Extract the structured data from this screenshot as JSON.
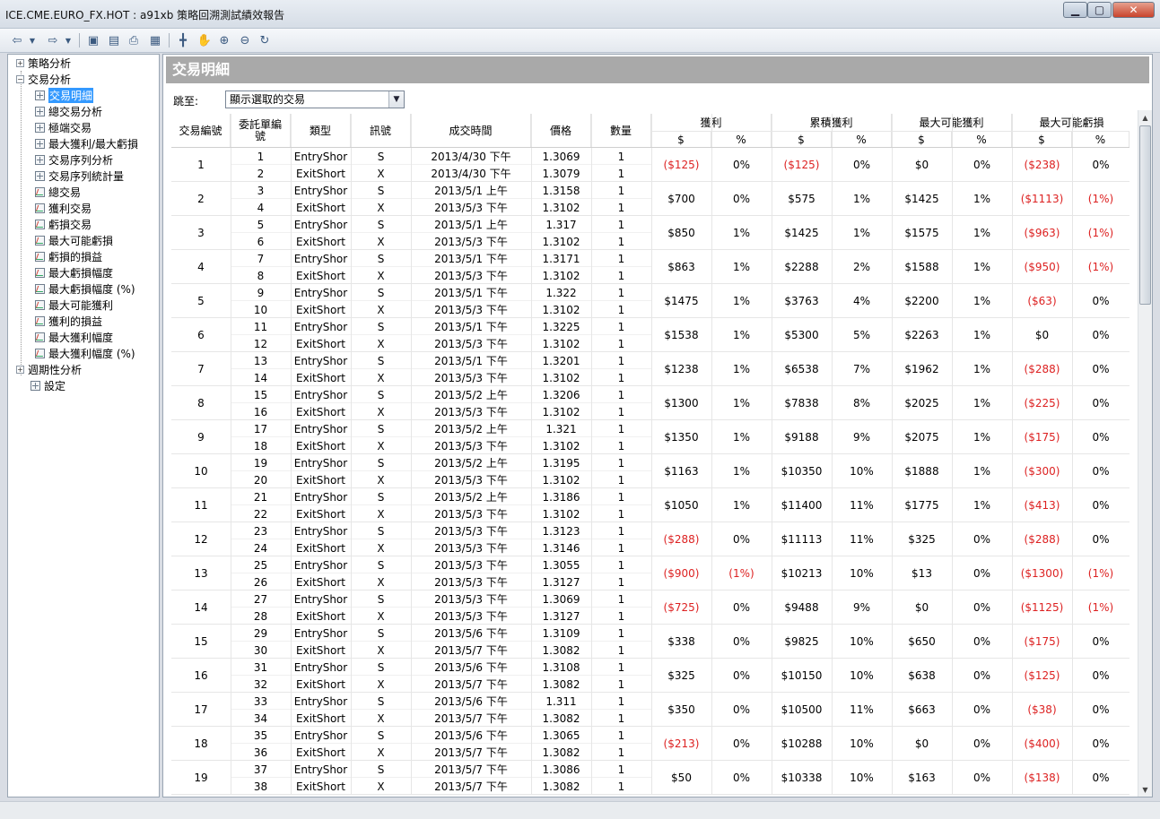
{
  "window": {
    "title": "ICE.CME.EURO_FX.HOT : a91xb 策略回溯測試績效報告"
  },
  "colors": {
    "negative": "#dd2222",
    "header_bar": "#a9a9a9"
  },
  "toolbar": {
    "icons": [
      "back-arrow-icon",
      "dropdown-icon",
      "forward-arrow-icon",
      "dropdown-icon",
      "save-icon",
      "export-icon",
      "print-icon",
      "view-icon",
      "crosshair-icon",
      "pan-hand-icon",
      "zoom-in-icon",
      "zoom-out-icon",
      "reset-zoom-icon"
    ]
  },
  "sidebar": {
    "groups": [
      {
        "label": "策略分析",
        "expanded": false
      },
      {
        "label": "交易分析",
        "expanded": true
      },
      {
        "label": "週期性分析",
        "expanded": false
      },
      {
        "label": "設定",
        "expanded": false
      }
    ],
    "items": [
      {
        "label": "交易明細",
        "icon": "grid",
        "selected": true
      },
      {
        "label": "總交易分析",
        "icon": "grid"
      },
      {
        "label": "極端交易",
        "icon": "grid"
      },
      {
        "label": "最大獲利/最大虧損",
        "icon": "grid"
      },
      {
        "label": "交易序列分析",
        "icon": "grid"
      },
      {
        "label": "交易序列統計量",
        "icon": "grid"
      },
      {
        "label": "總交易",
        "icon": "chart"
      },
      {
        "label": "獲利交易",
        "icon": "chart"
      },
      {
        "label": "虧損交易",
        "icon": "chart"
      },
      {
        "label": "最大可能虧損",
        "icon": "chart"
      },
      {
        "label": "虧損的損益",
        "icon": "chart"
      },
      {
        "label": "最大虧損幅度",
        "icon": "chart"
      },
      {
        "label": "最大虧損幅度 (%)",
        "icon": "chart"
      },
      {
        "label": "最大可能獲利",
        "icon": "chart"
      },
      {
        "label": "獲利的損益",
        "icon": "chart"
      },
      {
        "label": "最大獲利幅度",
        "icon": "chart"
      },
      {
        "label": "最大獲利幅度 (%)",
        "icon": "chart"
      }
    ]
  },
  "main": {
    "section_title": "交易明細",
    "jump_label": "跳至:",
    "jump_value": "顯示選取的交易",
    "headers": {
      "trade_no": "交易編號",
      "order_no": "委託單編號",
      "type": "類型",
      "signal": "訊號",
      "time": "成交時間",
      "price": "價格",
      "qty": "數量",
      "profit": "獲利",
      "cum_profit": "累積獲利",
      "max_profit": "最大可能獲利",
      "max_loss": "最大可能虧損",
      "dollar": "$",
      "pct": "%"
    },
    "trades": [
      {
        "no": "1",
        "legs": [
          [
            "1",
            "EntryShor",
            "S",
            "2013/4/30 下午",
            "1.3069",
            "1"
          ],
          [
            "2",
            "ExitShort",
            "X",
            "2013/4/30 下午",
            "1.3079",
            "1"
          ]
        ],
        "p": "($125)",
        "pp": "0%",
        "c": "($125)",
        "cp": "0%",
        "mp": "$0",
        "mpp": "0%",
        "ml": "($238)",
        "mlp": "0%"
      },
      {
        "no": "2",
        "legs": [
          [
            "3",
            "EntryShor",
            "S",
            "2013/5/1 上午",
            "1.3158",
            "1"
          ],
          [
            "4",
            "ExitShort",
            "X",
            "2013/5/3 下午",
            "1.3102",
            "1"
          ]
        ],
        "p": "$700",
        "pp": "0%",
        "c": "$575",
        "cp": "1%",
        "mp": "$1425",
        "mpp": "1%",
        "ml": "($1113)",
        "mlp": "(1%)"
      },
      {
        "no": "3",
        "legs": [
          [
            "5",
            "EntryShor",
            "S",
            "2013/5/1 上午",
            "1.317",
            "1"
          ],
          [
            "6",
            "ExitShort",
            "X",
            "2013/5/3 下午",
            "1.3102",
            "1"
          ]
        ],
        "p": "$850",
        "pp": "1%",
        "c": "$1425",
        "cp": "1%",
        "mp": "$1575",
        "mpp": "1%",
        "ml": "($963)",
        "mlp": "(1%)"
      },
      {
        "no": "4",
        "legs": [
          [
            "7",
            "EntryShor",
            "S",
            "2013/5/1 下午",
            "1.3171",
            "1"
          ],
          [
            "8",
            "ExitShort",
            "X",
            "2013/5/3 下午",
            "1.3102",
            "1"
          ]
        ],
        "p": "$863",
        "pp": "1%",
        "c": "$2288",
        "cp": "2%",
        "mp": "$1588",
        "mpp": "1%",
        "ml": "($950)",
        "mlp": "(1%)"
      },
      {
        "no": "5",
        "legs": [
          [
            "9",
            "EntryShor",
            "S",
            "2013/5/1 下午",
            "1.322",
            "1"
          ],
          [
            "10",
            "ExitShort",
            "X",
            "2013/5/3 下午",
            "1.3102",
            "1"
          ]
        ],
        "p": "$1475",
        "pp": "1%",
        "c": "$3763",
        "cp": "4%",
        "mp": "$2200",
        "mpp": "1%",
        "ml": "($63)",
        "mlp": "0%"
      },
      {
        "no": "6",
        "legs": [
          [
            "11",
            "EntryShor",
            "S",
            "2013/5/1 下午",
            "1.3225",
            "1"
          ],
          [
            "12",
            "ExitShort",
            "X",
            "2013/5/3 下午",
            "1.3102",
            "1"
          ]
        ],
        "p": "$1538",
        "pp": "1%",
        "c": "$5300",
        "cp": "5%",
        "mp": "$2263",
        "mpp": "1%",
        "ml": "$0",
        "mlp": "0%"
      },
      {
        "no": "7",
        "legs": [
          [
            "13",
            "EntryShor",
            "S",
            "2013/5/1 下午",
            "1.3201",
            "1"
          ],
          [
            "14",
            "ExitShort",
            "X",
            "2013/5/3 下午",
            "1.3102",
            "1"
          ]
        ],
        "p": "$1238",
        "pp": "1%",
        "c": "$6538",
        "cp": "7%",
        "mp": "$1962",
        "mpp": "1%",
        "ml": "($288)",
        "mlp": "0%"
      },
      {
        "no": "8",
        "legs": [
          [
            "15",
            "EntryShor",
            "S",
            "2013/5/2 上午",
            "1.3206",
            "1"
          ],
          [
            "16",
            "ExitShort",
            "X",
            "2013/5/3 下午",
            "1.3102",
            "1"
          ]
        ],
        "p": "$1300",
        "pp": "1%",
        "c": "$7838",
        "cp": "8%",
        "mp": "$2025",
        "mpp": "1%",
        "ml": "($225)",
        "mlp": "0%"
      },
      {
        "no": "9",
        "legs": [
          [
            "17",
            "EntryShor",
            "S",
            "2013/5/2 上午",
            "1.321",
            "1"
          ],
          [
            "18",
            "ExitShort",
            "X",
            "2013/5/3 下午",
            "1.3102",
            "1"
          ]
        ],
        "p": "$1350",
        "pp": "1%",
        "c": "$9188",
        "cp": "9%",
        "mp": "$2075",
        "mpp": "1%",
        "ml": "($175)",
        "mlp": "0%"
      },
      {
        "no": "10",
        "legs": [
          [
            "19",
            "EntryShor",
            "S",
            "2013/5/2 上午",
            "1.3195",
            "1"
          ],
          [
            "20",
            "ExitShort",
            "X",
            "2013/5/3 下午",
            "1.3102",
            "1"
          ]
        ],
        "p": "$1163",
        "pp": "1%",
        "c": "$10350",
        "cp": "10%",
        "mp": "$1888",
        "mpp": "1%",
        "ml": "($300)",
        "mlp": "0%"
      },
      {
        "no": "11",
        "legs": [
          [
            "21",
            "EntryShor",
            "S",
            "2013/5/2 上午",
            "1.3186",
            "1"
          ],
          [
            "22",
            "ExitShort",
            "X",
            "2013/5/3 下午",
            "1.3102",
            "1"
          ]
        ],
        "p": "$1050",
        "pp": "1%",
        "c": "$11400",
        "cp": "11%",
        "mp": "$1775",
        "mpp": "1%",
        "ml": "($413)",
        "mlp": "0%"
      },
      {
        "no": "12",
        "legs": [
          [
            "23",
            "EntryShor",
            "S",
            "2013/5/3 下午",
            "1.3123",
            "1"
          ],
          [
            "24",
            "ExitShort",
            "X",
            "2013/5/3 下午",
            "1.3146",
            "1"
          ]
        ],
        "p": "($288)",
        "pp": "0%",
        "c": "$11113",
        "cp": "11%",
        "mp": "$325",
        "mpp": "0%",
        "ml": "($288)",
        "mlp": "0%"
      },
      {
        "no": "13",
        "legs": [
          [
            "25",
            "EntryShor",
            "S",
            "2013/5/3 下午",
            "1.3055",
            "1"
          ],
          [
            "26",
            "ExitShort",
            "X",
            "2013/5/3 下午",
            "1.3127",
            "1"
          ]
        ],
        "p": "($900)",
        "pp": "(1%)",
        "c": "$10213",
        "cp": "10%",
        "mp": "$13",
        "mpp": "0%",
        "ml": "($1300)",
        "mlp": "(1%)"
      },
      {
        "no": "14",
        "legs": [
          [
            "27",
            "EntryShor",
            "S",
            "2013/5/3 下午",
            "1.3069",
            "1"
          ],
          [
            "28",
            "ExitShort",
            "X",
            "2013/5/3 下午",
            "1.3127",
            "1"
          ]
        ],
        "p": "($725)",
        "pp": "0%",
        "c": "$9488",
        "cp": "9%",
        "mp": "$0",
        "mpp": "0%",
        "ml": "($1125)",
        "mlp": "(1%)"
      },
      {
        "no": "15",
        "legs": [
          [
            "29",
            "EntryShor",
            "S",
            "2013/5/6 下午",
            "1.3109",
            "1"
          ],
          [
            "30",
            "ExitShort",
            "X",
            "2013/5/7 下午",
            "1.3082",
            "1"
          ]
        ],
        "p": "$338",
        "pp": "0%",
        "c": "$9825",
        "cp": "10%",
        "mp": "$650",
        "mpp": "0%",
        "ml": "($175)",
        "mlp": "0%"
      },
      {
        "no": "16",
        "legs": [
          [
            "31",
            "EntryShor",
            "S",
            "2013/5/6 下午",
            "1.3108",
            "1"
          ],
          [
            "32",
            "ExitShort",
            "X",
            "2013/5/7 下午",
            "1.3082",
            "1"
          ]
        ],
        "p": "$325",
        "pp": "0%",
        "c": "$10150",
        "cp": "10%",
        "mp": "$638",
        "mpp": "0%",
        "ml": "($125)",
        "mlp": "0%"
      },
      {
        "no": "17",
        "legs": [
          [
            "33",
            "EntryShor",
            "S",
            "2013/5/6 下午",
            "1.311",
            "1"
          ],
          [
            "34",
            "ExitShort",
            "X",
            "2013/5/7 下午",
            "1.3082",
            "1"
          ]
        ],
        "p": "$350",
        "pp": "0%",
        "c": "$10500",
        "cp": "11%",
        "mp": "$663",
        "mpp": "0%",
        "ml": "($38)",
        "mlp": "0%"
      },
      {
        "no": "18",
        "legs": [
          [
            "35",
            "EntryShor",
            "S",
            "2013/5/6 下午",
            "1.3065",
            "1"
          ],
          [
            "36",
            "ExitShort",
            "X",
            "2013/5/7 下午",
            "1.3082",
            "1"
          ]
        ],
        "p": "($213)",
        "pp": "0%",
        "c": "$10288",
        "cp": "10%",
        "mp": "$0",
        "mpp": "0%",
        "ml": "($400)",
        "mlp": "0%"
      },
      {
        "no": "19",
        "legs": [
          [
            "37",
            "EntryShor",
            "S",
            "2013/5/7 下午",
            "1.3086",
            "1"
          ],
          [
            "38",
            "ExitShort",
            "X",
            "2013/5/7 下午",
            "1.3082",
            "1"
          ]
        ],
        "p": "$50",
        "pp": "0%",
        "c": "$10338",
        "cp": "10%",
        "mp": "$163",
        "mpp": "0%",
        "ml": "($138)",
        "mlp": "0%"
      }
    ]
  }
}
